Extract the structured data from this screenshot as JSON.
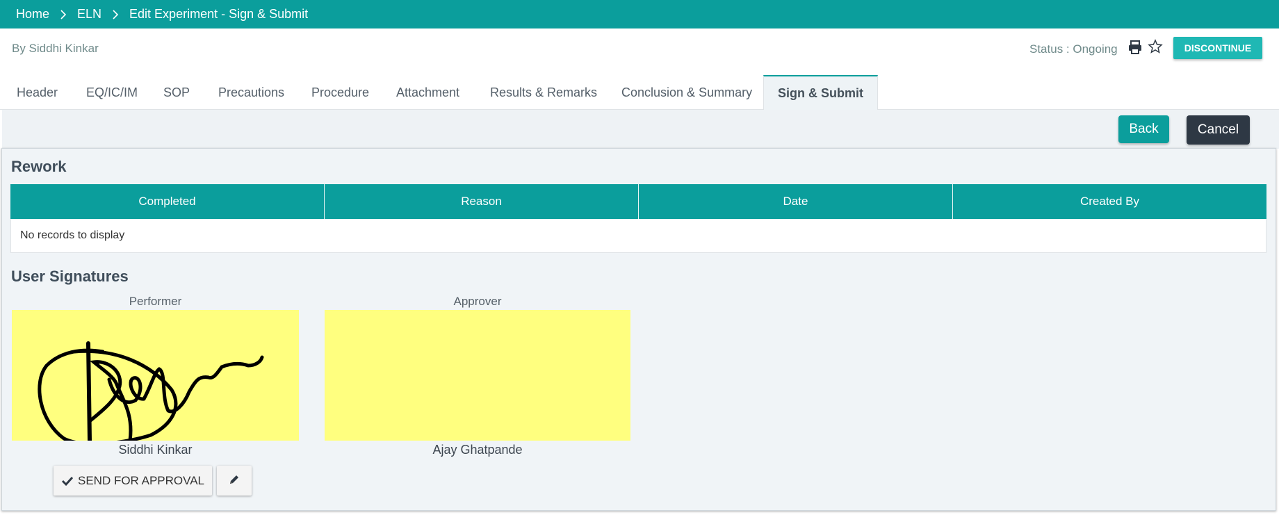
{
  "breadcrumb": {
    "items": [
      "Home",
      "ELN",
      "Edit Experiment - Sign & Submit"
    ]
  },
  "header": {
    "author": "By Siddhi Kinkar",
    "status": "Status : Ongoing",
    "discontinue_label": "DISCONTINUE"
  },
  "tabs": [
    "Header",
    "EQ/IC/IM",
    "SOP",
    "Precautions",
    "Procedure",
    "Attachment",
    "Results & Remarks",
    "Conclusion & Summary",
    "Sign & Submit"
  ],
  "active_tab": "Sign & Submit",
  "actions": {
    "back_label": "Back",
    "cancel_label": "Cancel"
  },
  "rework": {
    "title": "Rework",
    "columns": [
      "Completed",
      "Reason",
      "Date",
      "Created By"
    ],
    "empty_text": "No records to display"
  },
  "signatures": {
    "title": "User Signatures",
    "performer": {
      "role": "Performer",
      "name": "Siddhi Kinkar"
    },
    "approver": {
      "role": "Approver",
      "name": "Ajay Ghatpande"
    },
    "send_label": "SEND FOR APPROVAL"
  },
  "colors": {
    "primary": "#0b9e9c",
    "accent": "#1fb8b4",
    "dark": "#2e3844",
    "signature_bg": "#ffff7f"
  },
  "icons": [
    "chevron-right-icon",
    "print-icon",
    "star-icon",
    "check-icon",
    "pencil-icon"
  ]
}
